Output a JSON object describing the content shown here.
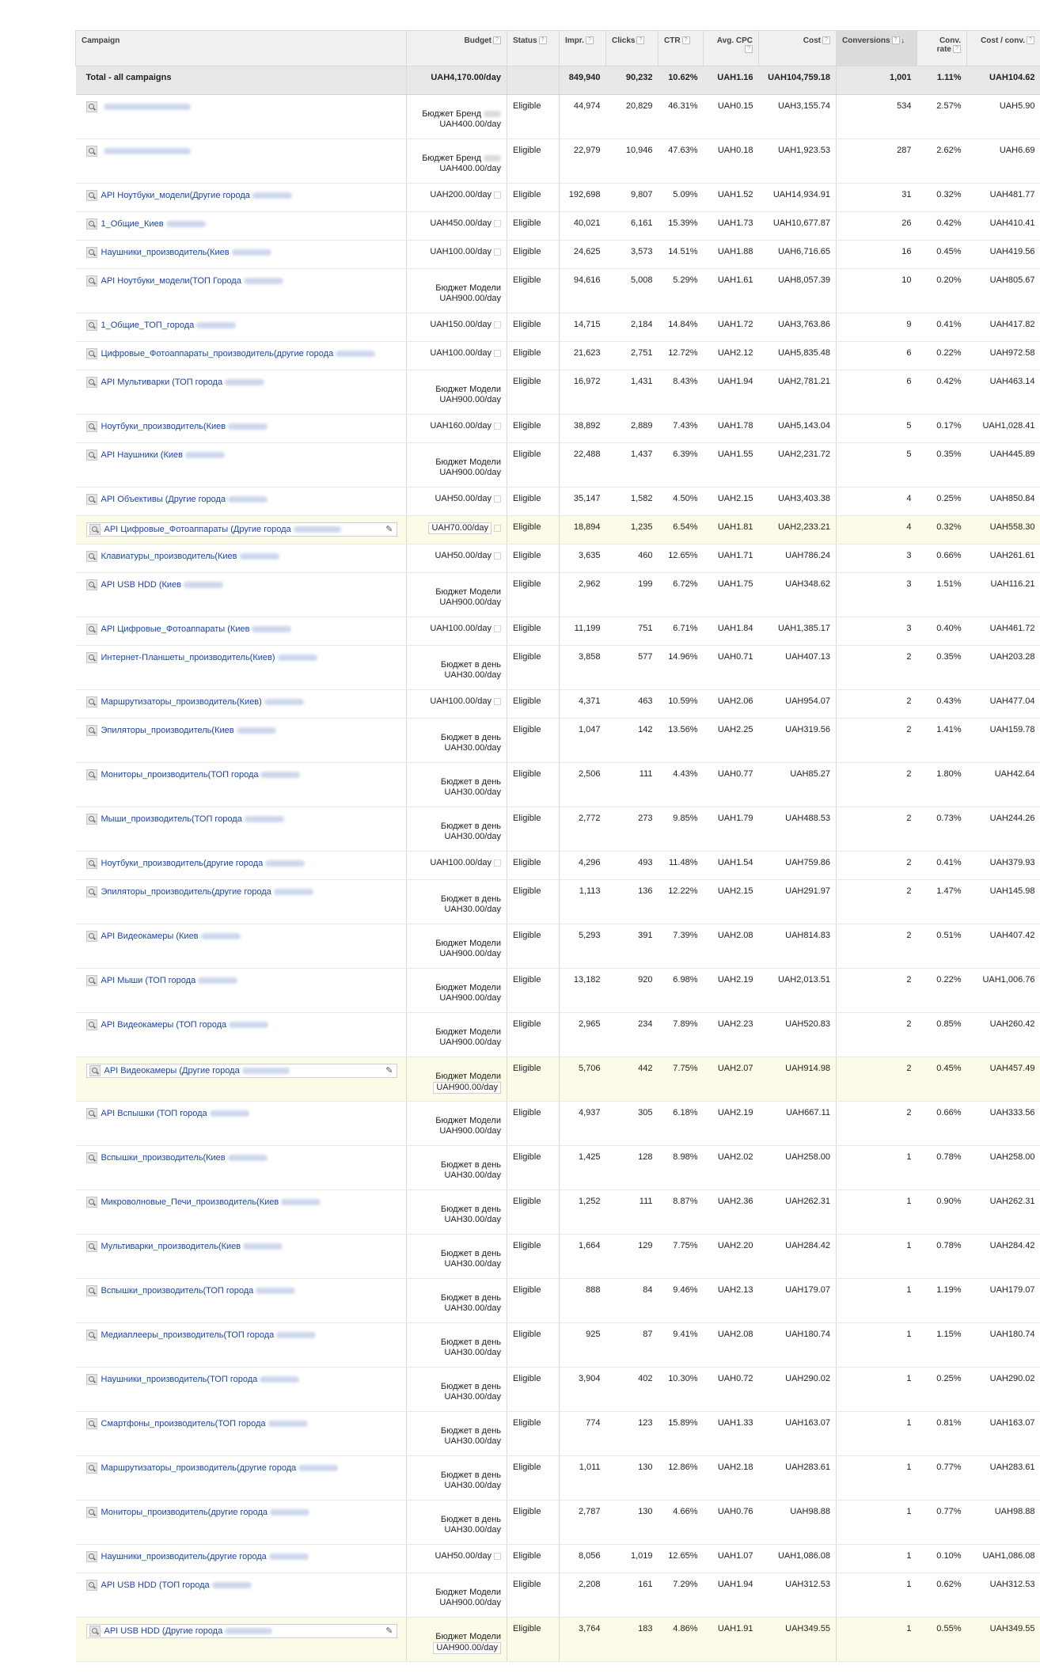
{
  "headers": {
    "campaign": "Campaign",
    "budget": "Budget",
    "status": "Status",
    "impr": "Impr.",
    "clicks": "Clicks",
    "ctr": "CTR",
    "cpc": "Avg. CPC",
    "cost": "Cost",
    "conversions": "Conversions",
    "conv_rate": "Conv. rate",
    "cost_conv": "Cost / conv.",
    "help": "?",
    "sort_arrow": "↓"
  },
  "total": {
    "label": "Total - all campaigns",
    "budget": "UAH4,170.00/day",
    "status": "",
    "impr": "849,940",
    "clicks": "90,232",
    "ctr": "10.62%",
    "cpc": "UAH1.16",
    "cost": "UAH104,759.18",
    "conversions": "1,001",
    "conv_rate": "1.11%",
    "cost_conv": "UAH104.62"
  },
  "rows": [
    {
      "name": "",
      "budget_main": "",
      "budget_label": "Бюджет Бренд",
      "budget_sub": "UAH400.00/day",
      "status": "Eligible",
      "impr": "44,974",
      "clicks": "20,829",
      "ctr": "46.31%",
      "cpc": "UAH0.15",
      "cost": "UAH3,155.74",
      "conversions": "534",
      "conv_rate": "2.57%",
      "cost_conv": "UAH5.90"
    },
    {
      "name": "",
      "budget_main": "",
      "budget_label": "Бюджет Бренд",
      "budget_sub": "UAH400.00/day",
      "status": "Eligible",
      "impr": "22,979",
      "clicks": "10,946",
      "ctr": "47.63%",
      "cpc": "UAH0.18",
      "cost": "UAH1,923.53",
      "conversions": "287",
      "conv_rate": "2.62%",
      "cost_conv": "UAH6.69"
    },
    {
      "name": "API Ноутбуки_модели(Другие города",
      "budget_main": "UAH200.00/day",
      "budget_label": "",
      "budget_sub": "",
      "status": "Eligible",
      "impr": "192,698",
      "clicks": "9,807",
      "ctr": "5.09%",
      "cpc": "UAH1.52",
      "cost": "UAH14,934.91",
      "conversions": "31",
      "conv_rate": "0.32%",
      "cost_conv": "UAH481.77"
    },
    {
      "name": "1_Общие_Киев",
      "budget_main": "UAH450.00/day",
      "budget_label": "",
      "budget_sub": "",
      "status": "Eligible",
      "impr": "40,021",
      "clicks": "6,161",
      "ctr": "15.39%",
      "cpc": "UAH1.73",
      "cost": "UAH10,677.87",
      "conversions": "26",
      "conv_rate": "0.42%",
      "cost_conv": "UAH410.41"
    },
    {
      "name": "Наушники_производитель(Киев",
      "budget_main": "UAH100.00/day",
      "budget_label": "",
      "budget_sub": "",
      "status": "Eligible",
      "impr": "24,625",
      "clicks": "3,573",
      "ctr": "14.51%",
      "cpc": "UAH1.88",
      "cost": "UAH6,716.65",
      "conversions": "16",
      "conv_rate": "0.45%",
      "cost_conv": "UAH419.56"
    },
    {
      "name": "API Ноутбуки_модели(ТОП Города",
      "budget_main": "",
      "budget_label": "Бюджет Модели",
      "budget_sub": "UAH900.00/day",
      "status": "Eligible",
      "impr": "94,616",
      "clicks": "5,008",
      "ctr": "5.29%",
      "cpc": "UAH1.61",
      "cost": "UAH8,057.39",
      "conversions": "10",
      "conv_rate": "0.20%",
      "cost_conv": "UAH805.67"
    },
    {
      "name": "1_Общие_ТОП_города",
      "budget_main": "UAH150.00/day",
      "budget_label": "",
      "budget_sub": "",
      "status": "Eligible",
      "impr": "14,715",
      "clicks": "2,184",
      "ctr": "14.84%",
      "cpc": "UAH1.72",
      "cost": "UAH3,763.86",
      "conversions": "9",
      "conv_rate": "0.41%",
      "cost_conv": "UAH417.82"
    },
    {
      "name": "Цифровые_Фотоаппараты_производитель(другие города",
      "budget_main": "UAH100.00/day",
      "budget_label": "",
      "budget_sub": "",
      "status": "Eligible",
      "impr": "21,623",
      "clicks": "2,751",
      "ctr": "12.72%",
      "cpc": "UAH2.12",
      "cost": "UAH5,835.48",
      "conversions": "6",
      "conv_rate": "0.22%",
      "cost_conv": "UAH972.58"
    },
    {
      "name": "API Мультиварки (ТОП города",
      "budget_main": "",
      "budget_label": "Бюджет Модели",
      "budget_sub": "UAH900.00/day",
      "status": "Eligible",
      "impr": "16,972",
      "clicks": "1,431",
      "ctr": "8.43%",
      "cpc": "UAH1.94",
      "cost": "UAH2,781.21",
      "conversions": "6",
      "conv_rate": "0.42%",
      "cost_conv": "UAH463.14"
    },
    {
      "name": "Ноутбуки_производитель(Киев",
      "budget_main": "UAH160.00/day",
      "budget_label": "",
      "budget_sub": "",
      "status": "Eligible",
      "impr": "38,892",
      "clicks": "2,889",
      "ctr": "7.43%",
      "cpc": "UAH1.78",
      "cost": "UAH5,143.04",
      "conversions": "5",
      "conv_rate": "0.17%",
      "cost_conv": "UAH1,028.41"
    },
    {
      "name": "API Наушники (Киев",
      "budget_main": "",
      "budget_label": "Бюджет Модели",
      "budget_sub": "UAH900.00/day",
      "status": "Eligible",
      "impr": "22,488",
      "clicks": "1,437",
      "ctr": "6.39%",
      "cpc": "UAH1.55",
      "cost": "UAH2,231.72",
      "conversions": "5",
      "conv_rate": "0.35%",
      "cost_conv": "UAH445.89"
    },
    {
      "name": "API Объективы (Другие города",
      "budget_main": "UAH50.00/day",
      "budget_label": "",
      "budget_sub": "",
      "status": "Eligible",
      "impr": "35,147",
      "clicks": "1,582",
      "ctr": "4.50%",
      "cpc": "UAH2.15",
      "cost": "UAH3,403.38",
      "conversions": "4",
      "conv_rate": "0.25%",
      "cost_conv": "UAH850.84"
    },
    {
      "name": "API Цифровые_Фотоаппараты (Другие города",
      "budget_main": "UAH70.00/day",
      "budget_label": "",
      "budget_sub": "",
      "status": "Eligible",
      "impr": "18,894",
      "clicks": "1,235",
      "ctr": "6.54%",
      "cpc": "UAH1.81",
      "cost": "UAH2,233.21",
      "conversions": "4",
      "conv_rate": "0.32%",
      "cost_conv": "UAH558.30",
      "hl": true
    },
    {
      "name": "Клавиатуры_производитель(Киев",
      "budget_main": "UAH50.00/day",
      "budget_label": "",
      "budget_sub": "",
      "status": "Eligible",
      "impr": "3,635",
      "clicks": "460",
      "ctr": "12.65%",
      "cpc": "UAH1.71",
      "cost": "UAH786.24",
      "conversions": "3",
      "conv_rate": "0.66%",
      "cost_conv": "UAH261.61"
    },
    {
      "name": "API USB HDD (Киев",
      "budget_main": "",
      "budget_label": "Бюджет Модели",
      "budget_sub": "UAH900.00/day",
      "status": "Eligible",
      "impr": "2,962",
      "clicks": "199",
      "ctr": "6.72%",
      "cpc": "UAH1.75",
      "cost": "UAH348.62",
      "conversions": "3",
      "conv_rate": "1.51%",
      "cost_conv": "UAH116.21"
    },
    {
      "name": "API Цифровые_Фотоаппараты (Киев",
      "budget_main": "UAH100.00/day",
      "budget_label": "",
      "budget_sub": "",
      "status": "Eligible",
      "impr": "11,199",
      "clicks": "751",
      "ctr": "6.71%",
      "cpc": "UAH1.84",
      "cost": "UAH1,385.17",
      "conversions": "3",
      "conv_rate": "0.40%",
      "cost_conv": "UAH461.72"
    },
    {
      "name": "Интернет-Планшеты_производитель(Киев)",
      "budget_main": "",
      "budget_label": "Бюджет в день",
      "budget_sub": "UAH30.00/day",
      "status": "Eligible",
      "impr": "3,858",
      "clicks": "577",
      "ctr": "14.96%",
      "cpc": "UAH0.71",
      "cost": "UAH407.13",
      "conversions": "2",
      "conv_rate": "0.35%",
      "cost_conv": "UAH203.28"
    },
    {
      "name": "Маршрутизаторы_производитель(Киев)",
      "budget_main": "UAH100.00/day",
      "budget_label": "",
      "budget_sub": "",
      "status": "Eligible",
      "impr": "4,371",
      "clicks": "463",
      "ctr": "10.59%",
      "cpc": "UAH2.06",
      "cost": "UAH954.07",
      "conversions": "2",
      "conv_rate": "0.43%",
      "cost_conv": "UAH477.04"
    },
    {
      "name": "Эпиляторы_производитель(Киев",
      "budget_main": "",
      "budget_label": "Бюджет в день",
      "budget_sub": "UAH30.00/day",
      "status": "Eligible",
      "impr": "1,047",
      "clicks": "142",
      "ctr": "13.56%",
      "cpc": "UAH2.25",
      "cost": "UAH319.56",
      "conversions": "2",
      "conv_rate": "1.41%",
      "cost_conv": "UAH159.78"
    },
    {
      "name": "Мониторы_производитель(ТОП города",
      "budget_main": "",
      "budget_label": "Бюджет в день",
      "budget_sub": "UAH30.00/day",
      "status": "Eligible",
      "impr": "2,506",
      "clicks": "111",
      "ctr": "4.43%",
      "cpc": "UAH0.77",
      "cost": "UAH85.27",
      "conversions": "2",
      "conv_rate": "1.80%",
      "cost_conv": "UAH42.64"
    },
    {
      "name": "Мыши_производитель(ТОП города",
      "budget_main": "",
      "budget_label": "Бюджет в день",
      "budget_sub": "UAH30.00/day",
      "status": "Eligible",
      "impr": "2,772",
      "clicks": "273",
      "ctr": "9.85%",
      "cpc": "UAH1.79",
      "cost": "UAH488.53",
      "conversions": "2",
      "conv_rate": "0.73%",
      "cost_conv": "UAH244.26"
    },
    {
      "name": "Ноутбуки_производитель(другие города",
      "budget_main": "UAH100.00/day",
      "budget_label": "",
      "budget_sub": "",
      "status": "Eligible",
      "impr": "4,296",
      "clicks": "493",
      "ctr": "11.48%",
      "cpc": "UAH1.54",
      "cost": "UAH759.86",
      "conversions": "2",
      "conv_rate": "0.41%",
      "cost_conv": "UAH379.93"
    },
    {
      "name": "Эпиляторы_производитель(другие города",
      "budget_main": "",
      "budget_label": "Бюджет в день",
      "budget_sub": "UAH30.00/day",
      "status": "Eligible",
      "impr": "1,113",
      "clicks": "136",
      "ctr": "12.22%",
      "cpc": "UAH2.15",
      "cost": "UAH291.97",
      "conversions": "2",
      "conv_rate": "1.47%",
      "cost_conv": "UAH145.98"
    },
    {
      "name": "API Видеокамеры (Киев",
      "budget_main": "",
      "budget_label": "Бюджет Модели",
      "budget_sub": "UAH900.00/day",
      "status": "Eligible",
      "impr": "5,293",
      "clicks": "391",
      "ctr": "7.39%",
      "cpc": "UAH2.08",
      "cost": "UAH814.83",
      "conversions": "2",
      "conv_rate": "0.51%",
      "cost_conv": "UAH407.42"
    },
    {
      "name": "API Мыши (ТОП города",
      "budget_main": "",
      "budget_label": "Бюджет Модели",
      "budget_sub": "UAH900.00/day",
      "status": "Eligible",
      "impr": "13,182",
      "clicks": "920",
      "ctr": "6.98%",
      "cpc": "UAH2.19",
      "cost": "UAH2,013.51",
      "conversions": "2",
      "conv_rate": "0.22%",
      "cost_conv": "UAH1,006.76"
    },
    {
      "name": "API Видеокамеры (ТОП города",
      "budget_main": "",
      "budget_label": "Бюджет Модели",
      "budget_sub": "UAH900.00/day",
      "status": "Eligible",
      "impr": "2,965",
      "clicks": "234",
      "ctr": "7.89%",
      "cpc": "UAH2.23",
      "cost": "UAH520.83",
      "conversions": "2",
      "conv_rate": "0.85%",
      "cost_conv": "UAH260.42"
    },
    {
      "name": "API Видеокамеры (Другие города",
      "budget_main": "",
      "budget_label": "Бюджет Модели",
      "budget_sub": "UAH900.00/day",
      "status": "Eligible",
      "impr": "5,706",
      "clicks": "442",
      "ctr": "7.75%",
      "cpc": "UAH2.07",
      "cost": "UAH914.98",
      "conversions": "2",
      "conv_rate": "0.45%",
      "cost_conv": "UAH457.49",
      "hl": true
    },
    {
      "name": "API Вспышки (ТОП города",
      "budget_main": "",
      "budget_label": "Бюджет Модели",
      "budget_sub": "UAH900.00/day",
      "status": "Eligible",
      "impr": "4,937",
      "clicks": "305",
      "ctr": "6.18%",
      "cpc": "UAH2.19",
      "cost": "UAH667.11",
      "conversions": "2",
      "conv_rate": "0.66%",
      "cost_conv": "UAH333.56"
    },
    {
      "name": "Вспышки_производитель(Киев",
      "budget_main": "",
      "budget_label": "Бюджет в день",
      "budget_sub": "UAH30.00/day",
      "status": "Eligible",
      "impr": "1,425",
      "clicks": "128",
      "ctr": "8.98%",
      "cpc": "UAH2.02",
      "cost": "UAH258.00",
      "conversions": "1",
      "conv_rate": "0.78%",
      "cost_conv": "UAH258.00"
    },
    {
      "name": "Микроволновые_Печи_производитель(Киев",
      "budget_main": "",
      "budget_label": "Бюджет в день",
      "budget_sub": "UAH30.00/day",
      "status": "Eligible",
      "impr": "1,252",
      "clicks": "111",
      "ctr": "8.87%",
      "cpc": "UAH2.36",
      "cost": "UAH262.31",
      "conversions": "1",
      "conv_rate": "0.90%",
      "cost_conv": "UAH262.31"
    },
    {
      "name": "Мультиварки_производитель(Киев",
      "budget_main": "",
      "budget_label": "Бюджет в день",
      "budget_sub": "UAH30.00/day",
      "status": "Eligible",
      "impr": "1,664",
      "clicks": "129",
      "ctr": "7.75%",
      "cpc": "UAH2.20",
      "cost": "UAH284.42",
      "conversions": "1",
      "conv_rate": "0.78%",
      "cost_conv": "UAH284.42"
    },
    {
      "name": "Вспышки_производитель(ТОП города",
      "budget_main": "",
      "budget_label": "Бюджет в день",
      "budget_sub": "UAH30.00/day",
      "status": "Eligible",
      "impr": "888",
      "clicks": "84",
      "ctr": "9.46%",
      "cpc": "UAH2.13",
      "cost": "UAH179.07",
      "conversions": "1",
      "conv_rate": "1.19%",
      "cost_conv": "UAH179.07"
    },
    {
      "name": "Медиаплееры_производитель(ТОП города",
      "budget_main": "",
      "budget_label": "Бюджет в день",
      "budget_sub": "UAH30.00/day",
      "status": "Eligible",
      "impr": "925",
      "clicks": "87",
      "ctr": "9.41%",
      "cpc": "UAH2.08",
      "cost": "UAH180.74",
      "conversions": "1",
      "conv_rate": "1.15%",
      "cost_conv": "UAH180.74"
    },
    {
      "name": "Наушники_производитель(ТОП города",
      "budget_main": "",
      "budget_label": "Бюджет в день",
      "budget_sub": "UAH30.00/day",
      "status": "Eligible",
      "impr": "3,904",
      "clicks": "402",
      "ctr": "10.30%",
      "cpc": "UAH0.72",
      "cost": "UAH290.02",
      "conversions": "1",
      "conv_rate": "0.25%",
      "cost_conv": "UAH290.02"
    },
    {
      "name": "Смартфоны_производитель(ТОП города",
      "budget_main": "",
      "budget_label": "Бюджет в день",
      "budget_sub": "UAH30.00/day",
      "status": "Eligible",
      "impr": "774",
      "clicks": "123",
      "ctr": "15.89%",
      "cpc": "UAH1.33",
      "cost": "UAH163.07",
      "conversions": "1",
      "conv_rate": "0.81%",
      "cost_conv": "UAH163.07"
    },
    {
      "name": "Маршрутизаторы_производитель(другие города",
      "budget_main": "",
      "budget_label": "Бюджет в день",
      "budget_sub": "UAH30.00/day",
      "status": "Eligible",
      "impr": "1,011",
      "clicks": "130",
      "ctr": "12.86%",
      "cpc": "UAH2.18",
      "cost": "UAH283.61",
      "conversions": "1",
      "conv_rate": "0.77%",
      "cost_conv": "UAH283.61"
    },
    {
      "name": "Мониторы_производитель(другие города",
      "budget_main": "",
      "budget_label": "Бюджет в день",
      "budget_sub": "UAH30.00/day",
      "status": "Eligible",
      "impr": "2,787",
      "clicks": "130",
      "ctr": "4.66%",
      "cpc": "UAH0.76",
      "cost": "UAH98.88",
      "conversions": "1",
      "conv_rate": "0.77%",
      "cost_conv": "UAH98.88"
    },
    {
      "name": "Наушники_производитель(другие города",
      "budget_main": "UAH50.00/day",
      "budget_label": "",
      "budget_sub": "",
      "status": "Eligible",
      "impr": "8,056",
      "clicks": "1,019",
      "ctr": "12.65%",
      "cpc": "UAH1.07",
      "cost": "UAH1,086.08",
      "conversions": "1",
      "conv_rate": "0.10%",
      "cost_conv": "UAH1,086.08"
    },
    {
      "name": "API USB HDD (ТОП города",
      "budget_main": "",
      "budget_label": "Бюджет Модели",
      "budget_sub": "UAH900.00/day",
      "status": "Eligible",
      "impr": "2,208",
      "clicks": "161",
      "ctr": "7.29%",
      "cpc": "UAH1.94",
      "cost": "UAH312.53",
      "conversions": "1",
      "conv_rate": "0.62%",
      "cost_conv": "UAH312.53"
    },
    {
      "name": "API USB HDD (Другие города",
      "budget_main": "",
      "budget_label": "Бюджет Модели",
      "budget_sub": "UAH900.00/day",
      "status": "Eligible",
      "impr": "3,764",
      "clicks": "183",
      "ctr": "4.86%",
      "cpc": "UAH1.91",
      "cost": "UAH349.55",
      "conversions": "1",
      "conv_rate": "0.55%",
      "cost_conv": "UAH349.55",
      "hl": true
    }
  ]
}
